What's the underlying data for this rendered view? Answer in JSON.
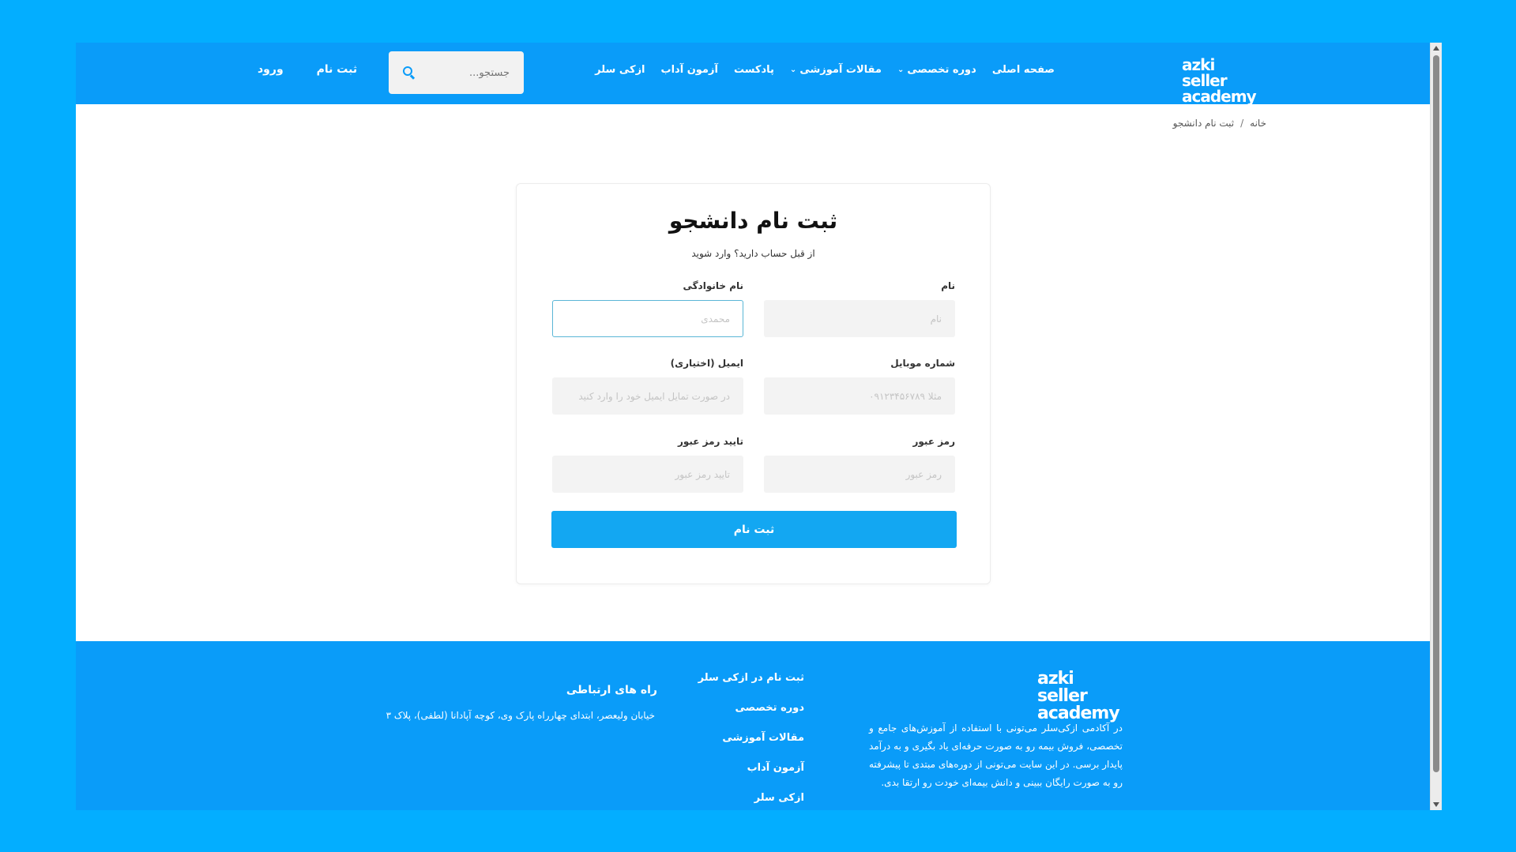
{
  "header": {
    "logo_line1": "azki seller",
    "logo_line2": "academy",
    "nav": [
      {
        "label": "صفحه اصلی",
        "has_dropdown": false
      },
      {
        "label": "دوره تخصصی",
        "has_dropdown": true
      },
      {
        "label": "مقالات آموزشی",
        "has_dropdown": true
      },
      {
        "label": "پادکست",
        "has_dropdown": false
      },
      {
        "label": "آزمون آداب",
        "has_dropdown": false
      },
      {
        "label": "ازکی سلر",
        "has_dropdown": false
      }
    ],
    "search_placeholder": "جستجو...",
    "register_label": "ثبت نام",
    "login_label": "ورود"
  },
  "breadcrumb": {
    "home": "خانه",
    "separator": "/",
    "current": "ثبت نام دانشجو"
  },
  "form": {
    "title": "ثبت نام دانشجو",
    "login_prompt": "از قبل حساب دارید؟ وارد شوید",
    "first_name": {
      "label": "نام",
      "placeholder": "نام"
    },
    "last_name": {
      "label": "نام خانوادگی",
      "placeholder": "محمدی"
    },
    "mobile": {
      "label": "شماره موبایل",
      "placeholder": "مثلا ۰۹۱۲۳۴۵۶۷۸۹"
    },
    "email": {
      "label": "ایمیل (اختیاری)",
      "placeholder": "در صورت تمایل ایمیل خود را وارد کنید"
    },
    "password": {
      "label": "رمز عبور",
      "placeholder": "رمز عبور"
    },
    "confirm_password": {
      "label": "تایید رمز عبور",
      "placeholder": "تایید رمز عبور"
    },
    "submit_label": "ثبت نام"
  },
  "footer": {
    "logo_line1": "azki seller",
    "logo_line2": "academy",
    "description": "در آکادمی ازکی‌سلر می‌تونی با استفاده از آموزش‌های جامع و تخصصی، فروش بیمه رو به صورت حرفه‌ای یاد بگیری و به درآمد پایدار برسی. در این سایت می‌تونی از دوره‌های مبتدی تا پیشرفته رو به صورت رایگان ببینی و دانش بیمه‌ای خودت رو ارتقا بدی.",
    "links": [
      "ثبت نام در ازکی سلر",
      "دوره تخصصی",
      "مقالات آموزشی",
      "آزمون آداب",
      "ازکی سلر"
    ],
    "contact_title": "راه های ارتباطی",
    "contact_address": "خیابان ولیعصر، ابتدای چهارراه پارک وی، کوچه آپادانا (لطفی)، پلاک ۳"
  },
  "colors": {
    "background": "#03aeff",
    "header": "#0a9cf9",
    "button": "#13a7f2"
  }
}
